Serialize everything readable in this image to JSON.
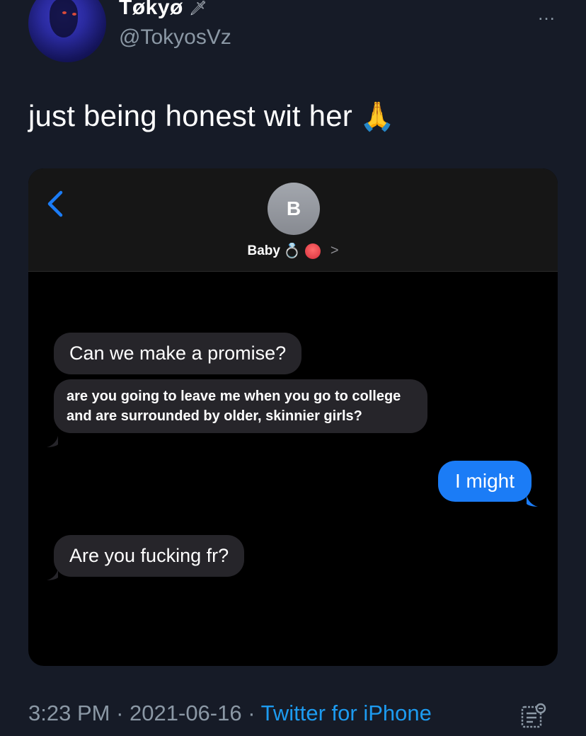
{
  "author": {
    "display_name": "Tøkyø",
    "name_emoji": "🗡",
    "handle": "@TokyosVz"
  },
  "more_icon": "…",
  "tweet": {
    "text": "just being honest wit her",
    "emoji": "🙏"
  },
  "conversation": {
    "contact_initial": "B",
    "contact_name": "Baby",
    "contact_emoji_ring": "💍",
    "chevron": ">",
    "messages": [
      {
        "side": "incoming",
        "text": "Can we make a promise?"
      },
      {
        "side": "incoming",
        "text": "are you going to leave me when you go to college and are surrounded by older, skinnier girls?"
      },
      {
        "side": "outgoing",
        "text": "I might"
      },
      {
        "side": "incoming",
        "text": "Are you fucking fr?"
      }
    ]
  },
  "footer": {
    "time": "3:23 PM",
    "date": "2021-06-16",
    "separator": "·",
    "source": "Twitter for iPhone"
  },
  "colors": {
    "background": "#161b27",
    "link_blue": "#1d9bf0",
    "imessage_blue": "#1b7cf6",
    "incoming_bubble": "#26252a",
    "muted_text": "#8b98a5"
  },
  "icons": [
    "more-icon",
    "back-chevron-icon",
    "chevron-right-icon",
    "analytics-icon"
  ]
}
